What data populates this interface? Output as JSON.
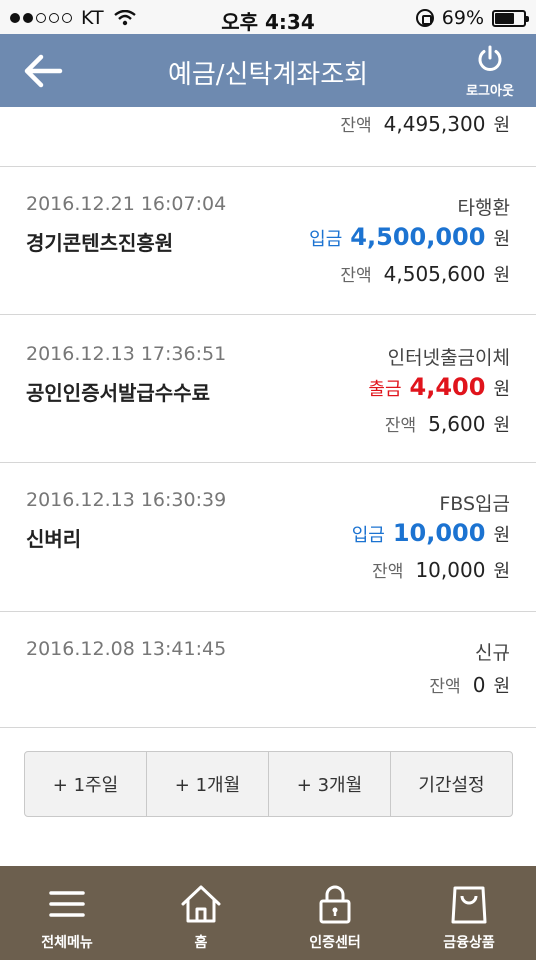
{
  "status_bar": {
    "carrier": "KT",
    "time": "오후 4:34",
    "battery": "69%",
    "battery_level": 0.69,
    "signal_dots": 5,
    "signal_filled": 2
  },
  "header": {
    "title": "예금/신탁계좌조회",
    "logout_label": "로그아웃"
  },
  "transactions": [
    {
      "date": "",
      "type": "",
      "name": "",
      "kind": "",
      "amount": "",
      "balance_label": "잔액",
      "balance": "4,495,300",
      "currency": "원"
    },
    {
      "date": "2016.12.21 16:07:04",
      "type": "타행환",
      "name": "경기콘텐츠진흥원",
      "kind": "입금",
      "amount": "4,500,000",
      "balance_label": "잔액",
      "balance": "4,505,600",
      "currency": "원"
    },
    {
      "date": "2016.12.13 17:36:51",
      "type": "인터넷출금이체",
      "name": "공인인증서발급수수료",
      "kind": "출금",
      "amount": "4,400",
      "balance_label": "잔액",
      "balance": "5,600",
      "currency": "원"
    },
    {
      "date": "2016.12.13 16:30:39",
      "type": "FBS입금",
      "name": "신벼리",
      "kind": "입금",
      "amount": "10,000",
      "balance_label": "잔액",
      "balance": "10,000",
      "currency": "원"
    },
    {
      "date": "2016.12.08 13:41:45",
      "type": "신규",
      "name": "",
      "kind": "",
      "amount": "",
      "balance_label": "잔액",
      "balance": "0",
      "currency": "원"
    }
  ],
  "period_buttons": [
    "+ 1주일",
    "+ 1개월",
    "+ 3개월",
    "기간설정"
  ],
  "bottom_nav": [
    {
      "label": "전체메뉴",
      "icon": "menu-icon"
    },
    {
      "label": "홈",
      "icon": "home-icon"
    },
    {
      "label": "인증센터",
      "icon": "lock-icon"
    },
    {
      "label": "금융상품",
      "icon": "bag-icon"
    }
  ],
  "colors": {
    "header": "#6e8ab0",
    "deposit": "#1c73d1",
    "withdrawal": "#e0141c",
    "bottom_nav": "#6c5f4e"
  }
}
